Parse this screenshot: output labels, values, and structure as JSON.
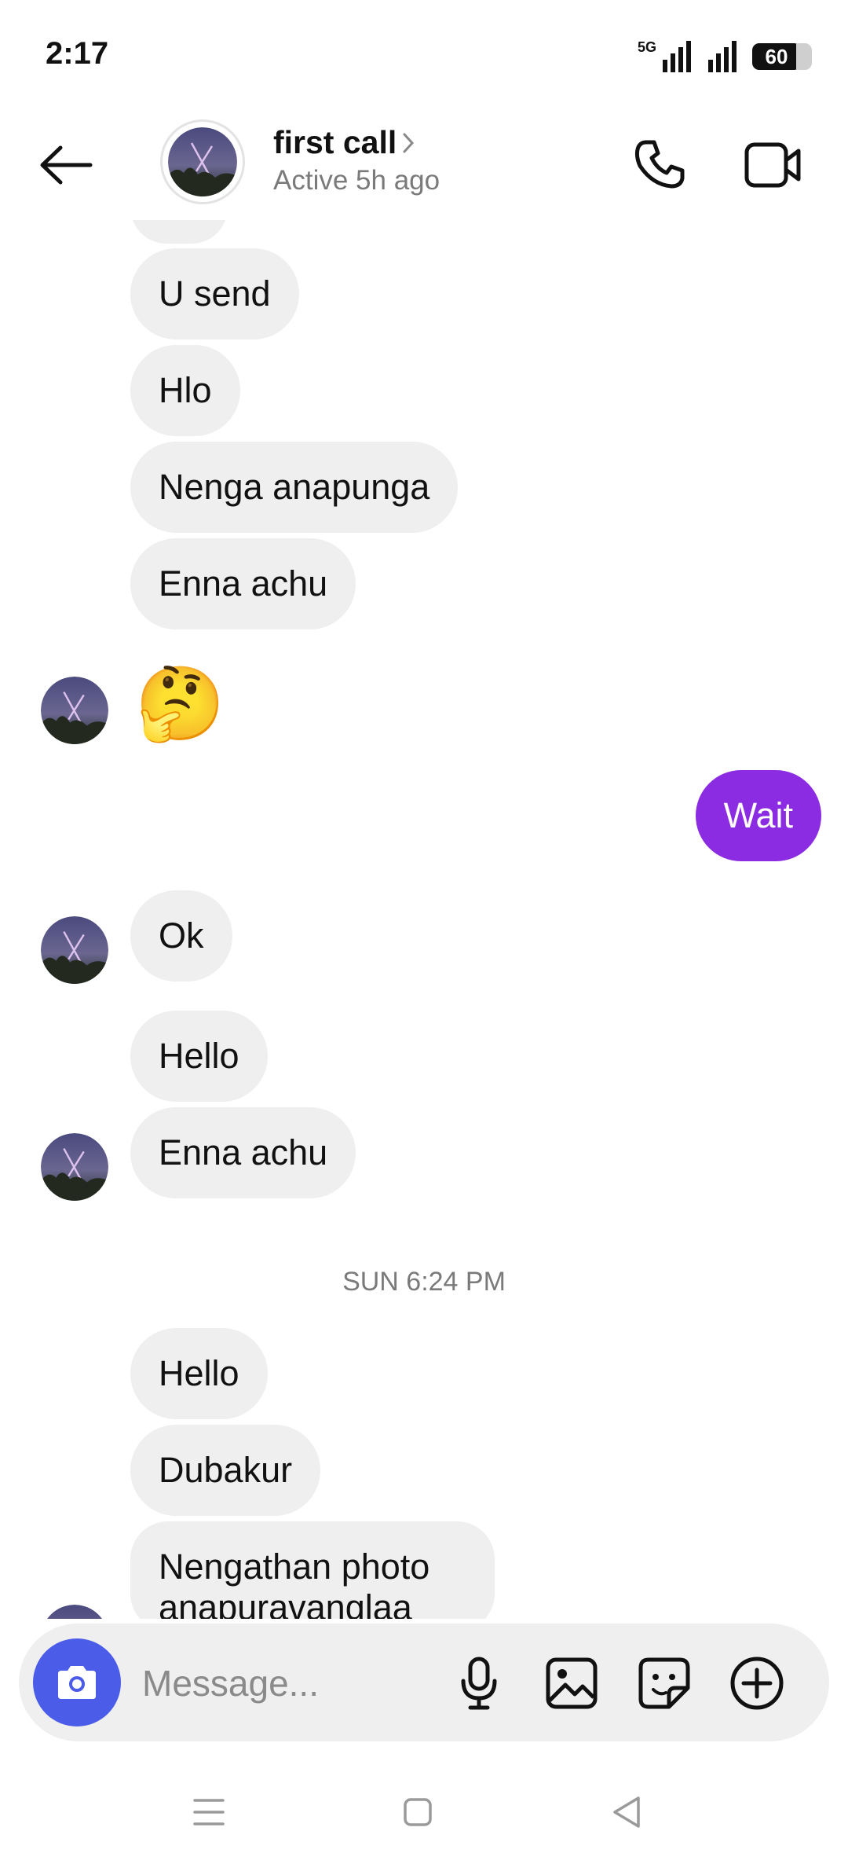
{
  "status_bar": {
    "time": "2:17",
    "network": "5G",
    "battery": "60"
  },
  "header": {
    "name": "first call",
    "status": "Active 5h ago"
  },
  "messages": {
    "incoming_1": "U send",
    "incoming_2": "Hlo",
    "incoming_3": "Nenga anapunga",
    "incoming_4": "Enna achu",
    "emoji": "🤔",
    "outgoing_1": "Wait",
    "incoming_5": "Ok",
    "incoming_6": "Hello",
    "incoming_7": "Enna achu",
    "timestamp": "SUN 6:24 PM",
    "incoming_8": "Hello",
    "incoming_9": "Dubakur",
    "incoming_10": "Nengathan photo anapuravanglaa"
  },
  "composer": {
    "placeholder": "Message..."
  },
  "icons": {
    "back": "arrow-left-icon",
    "call": "phone-icon",
    "video": "video-camera-icon",
    "camera": "camera-icon",
    "mic": "microphone-icon",
    "gallery": "image-icon",
    "sticker": "sticker-icon",
    "more": "plus-circle-icon",
    "nav_recents": "menu-icon",
    "nav_home": "square-icon",
    "nav_back": "triangle-back-icon"
  },
  "colors": {
    "outgoing_bubble": "#8b2be2",
    "incoming_bubble": "#efefef",
    "camera_button": "#4a5ce8",
    "secondary_text": "#7a7a7a"
  }
}
